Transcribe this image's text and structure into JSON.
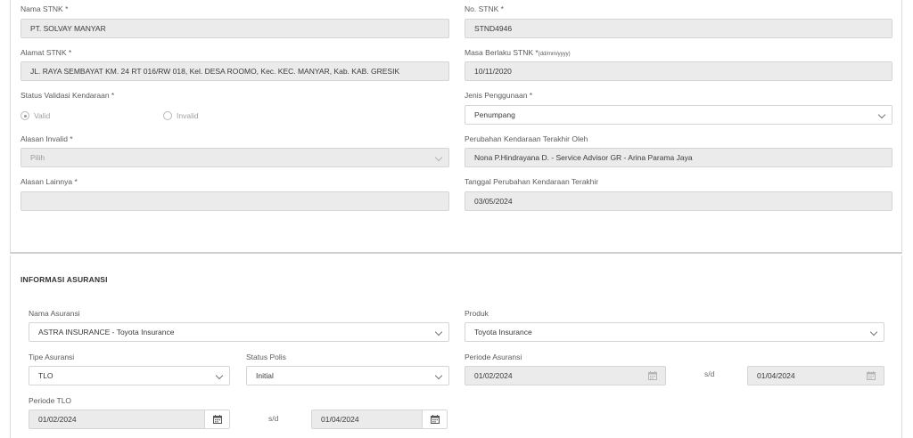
{
  "stnk": {
    "nama_label": "Nama STNK *",
    "nama_value": "PT. SOLVAY MANYAR",
    "no_label": "No. STNK *",
    "no_value": "STND4946",
    "alamat_label": "Alamat STNK *",
    "alamat_value": "JL. RAYA SEMBAYAT KM. 24 RT 016/RW 018, Kel. DESA ROOMO, Kec. KEC. MANYAR, Kab. KAB. GRESIK",
    "masa_label": "Masa Berlaku STNK *",
    "masa_hint": "(dd/mm/yyyy)",
    "masa_value": "10/11/2020",
    "status_label": "Status Validasi Kendaraan *",
    "status_valid": "Valid",
    "status_invalid": "Invalid",
    "status_selected": "Valid",
    "jenis_label": "Jenis Penggunaan *",
    "jenis_value": "Penumpang",
    "alasan_label": "Alasan Invalid *",
    "alasan_value": "Pilih",
    "perubahan_label": "Perubahan Kendaraan Terakhir Oleh",
    "perubahan_value": "Nona P.Hindrayana D. - Service Advisor GR - Arina Parama Jaya",
    "lainnya_label": "Alasan Lainnya *",
    "lainnya_value": "",
    "tanggal_label": "Tanggal Perubahan Kendaraan Terakhir",
    "tanggal_value": "03/05/2024"
  },
  "asuransi": {
    "section_title": "INFORMASI ASURANSI",
    "nama_label": "Nama Asuransi",
    "nama_value": "ASTRA INSURANCE - Toyota Insurance",
    "produk_label": "Produk",
    "produk_value": "Toyota Insurance",
    "tipe_label": "Tipe Asuransi",
    "tipe_value": "TLO",
    "status_polis_label": "Status Polis",
    "status_polis_value": "Initial",
    "periode_label": "Periode Asuransi",
    "periode_start": "01/02/2024",
    "periode_sd": "s/d",
    "periode_end": "01/04/2024",
    "tlo_label": "Periode TLO",
    "tlo_start": "01/02/2024",
    "tlo_sd": "s/d",
    "tlo_end": "01/04/2024"
  }
}
